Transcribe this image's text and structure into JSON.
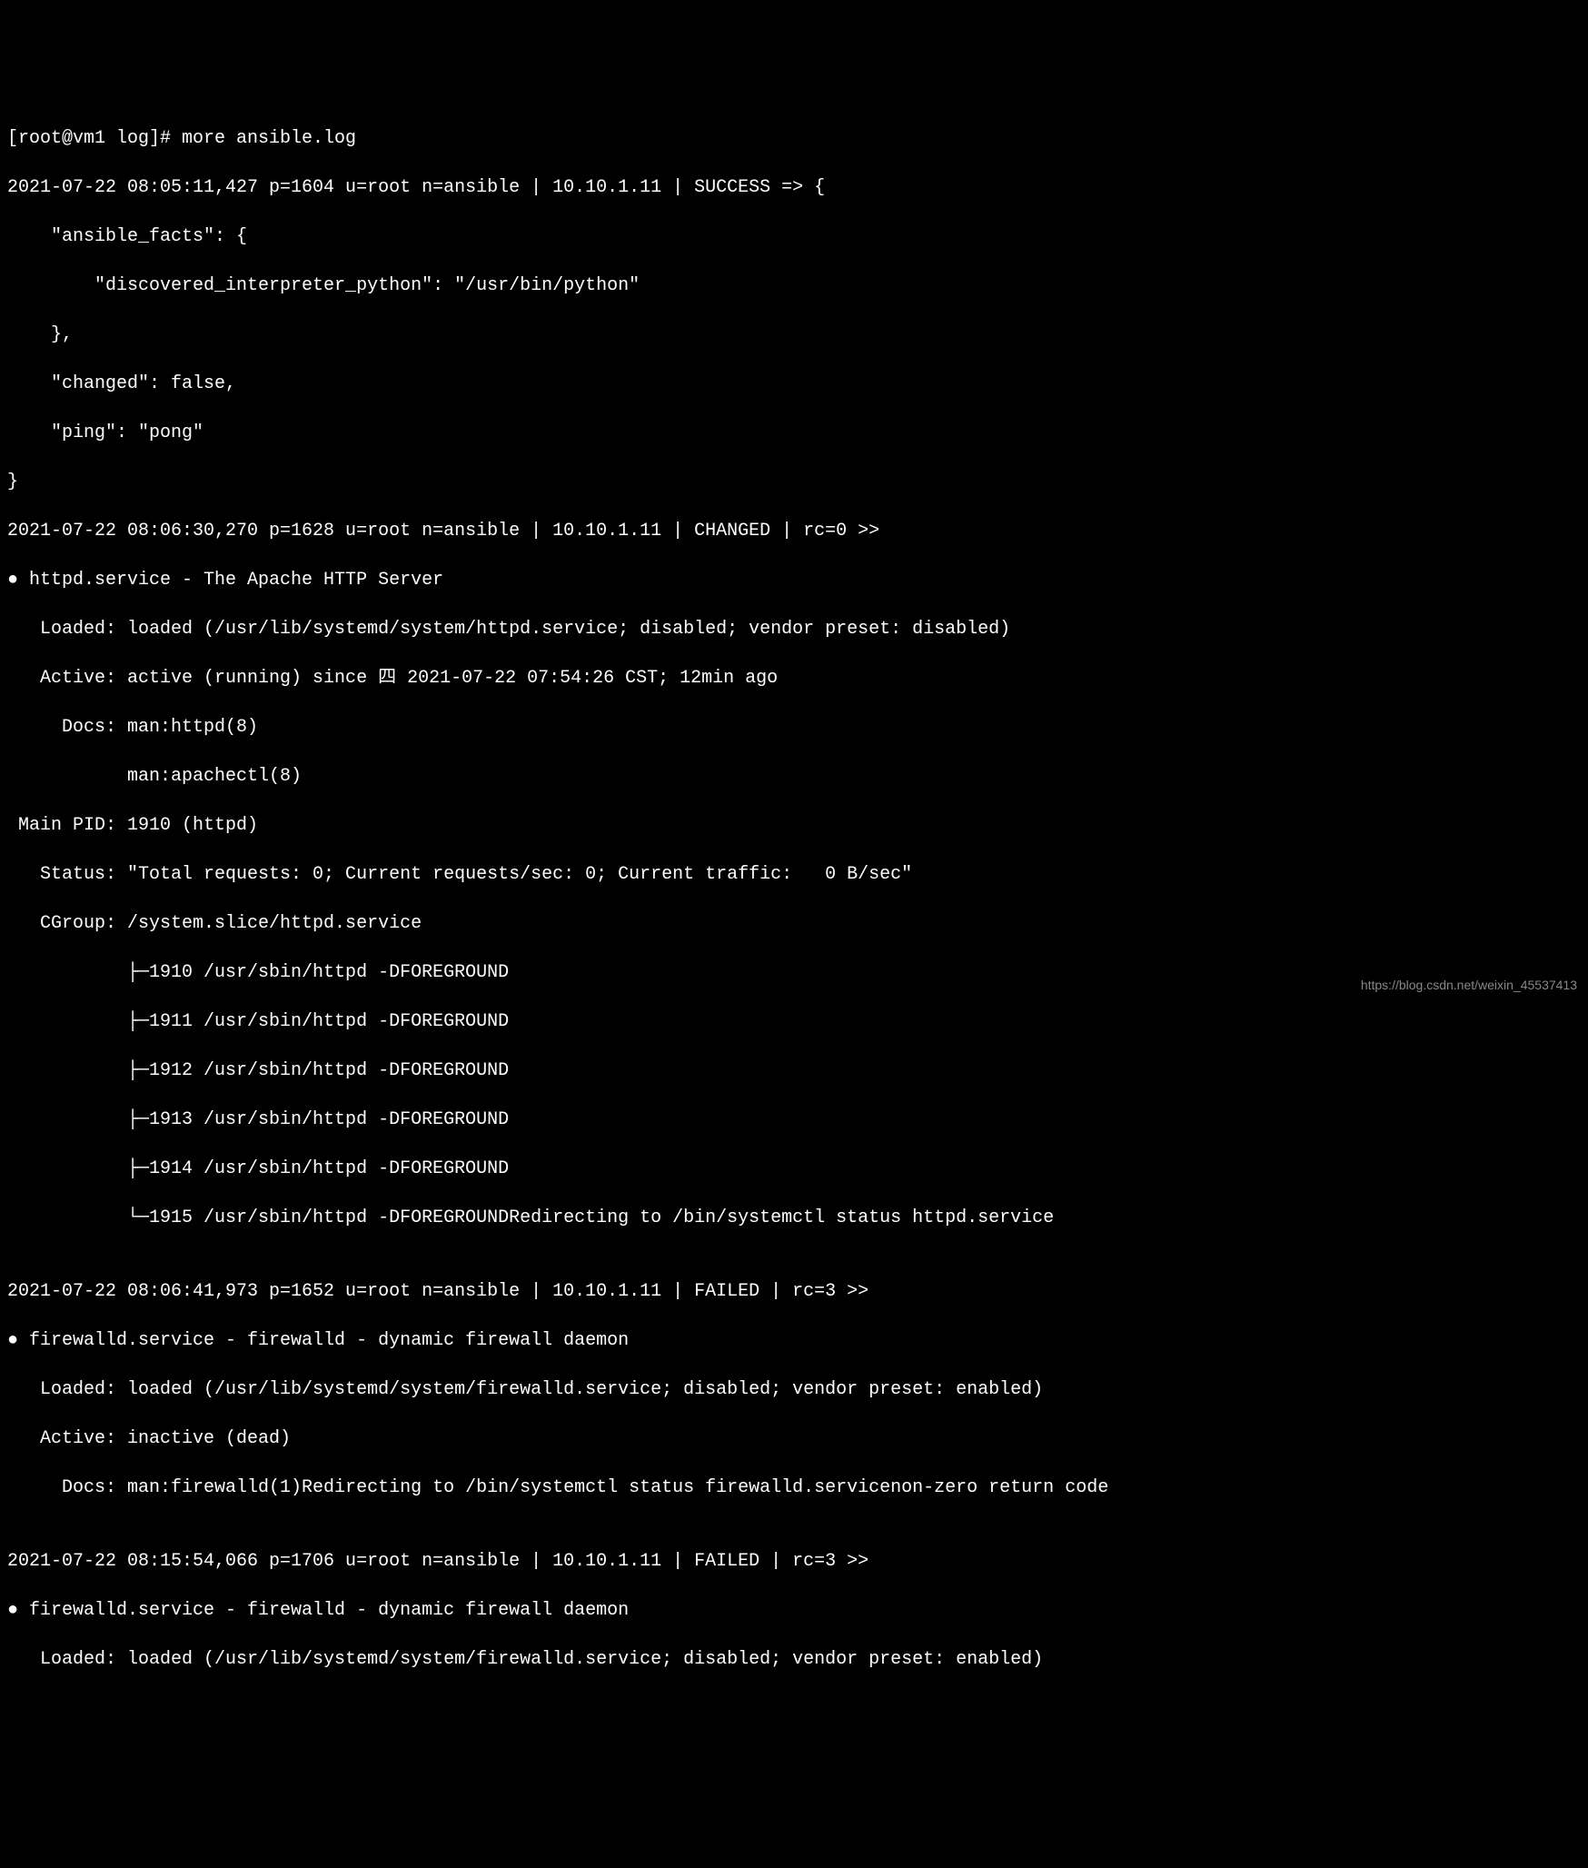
{
  "prompt": "[root@vm1 log]# more ansible.log",
  "lines": [
    "2021-07-22 08:05:11,427 p=1604 u=root n=ansible | 10.10.1.11 | SUCCESS => {",
    "    \"ansible_facts\": {",
    "        \"discovered_interpreter_python\": \"/usr/bin/python\"",
    "    },",
    "    \"changed\": false,",
    "    \"ping\": \"pong\"",
    "}",
    "2021-07-22 08:06:30,270 p=1628 u=root n=ansible | 10.10.1.11 | CHANGED | rc=0 >>",
    "● httpd.service - The Apache HTTP Server",
    "   Loaded: loaded (/usr/lib/systemd/system/httpd.service; disabled; vendor preset: disabled)",
    "   Active: active (running) since 四 2021-07-22 07:54:26 CST; 12min ago",
    "     Docs: man:httpd(8)",
    "           man:apachectl(8)",
    " Main PID: 1910 (httpd)",
    "   Status: \"Total requests: 0; Current requests/sec: 0; Current traffic:   0 B/sec\"",
    "   CGroup: /system.slice/httpd.service",
    "           ├─1910 /usr/sbin/httpd -DFOREGROUND",
    "           ├─1911 /usr/sbin/httpd -DFOREGROUND",
    "           ├─1912 /usr/sbin/httpd -DFOREGROUND",
    "           ├─1913 /usr/sbin/httpd -DFOREGROUND",
    "           ├─1914 /usr/sbin/httpd -DFOREGROUND",
    "           └─1915 /usr/sbin/httpd -DFOREGROUNDRedirecting to /bin/systemctl status httpd.service",
    "",
    "2021-07-22 08:06:41,973 p=1652 u=root n=ansible | 10.10.1.11 | FAILED | rc=3 >>",
    "● firewalld.service - firewalld - dynamic firewall daemon",
    "   Loaded: loaded (/usr/lib/systemd/system/firewalld.service; disabled; vendor preset: enabled)",
    "   Active: inactive (dead)",
    "     Docs: man:firewalld(1)Redirecting to /bin/systemctl status firewalld.servicenon-zero return code",
    "",
    "2021-07-22 08:15:54,066 p=1706 u=root n=ansible | 10.10.1.11 | FAILED | rc=3 >>",
    "● firewalld.service - firewalld - dynamic firewall daemon",
    "   Loaded: loaded (/usr/lib/systemd/system/firewalld.service; disabled; vendor preset: enabled)"
  ],
  "watermark": "https://blog.csdn.net/weixin_45537413"
}
